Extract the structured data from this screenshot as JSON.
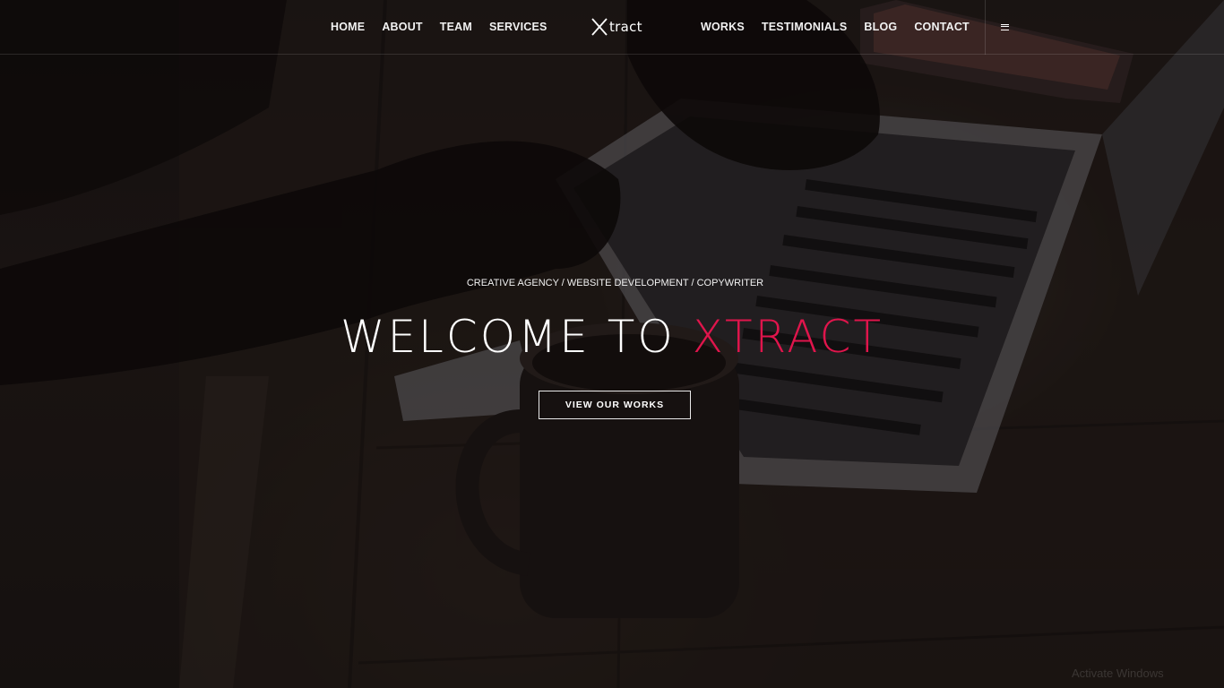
{
  "nav": {
    "left_links": [
      "HOME",
      "ABOUT",
      "TEAM",
      "SERVICES"
    ],
    "right_links": [
      "WORKS",
      "TESTIMONIALS",
      "BLOG",
      "CONTACT"
    ],
    "logo_text": "tract",
    "menu_icon": "hamburger-menu-icon"
  },
  "hero": {
    "tagline": "CREATIVE AGENCY / WEBSITE DEVELOPMENT / COPYWRITER",
    "headline_prefix": "WELCOME TO ",
    "headline_accent": "XTRACT",
    "cta_label": "VIEW OUR WORKS",
    "background": "photo of hands typing on a laptop beside a coffee mug and a smartphone on a wooden desk"
  },
  "system": {
    "watermark": "Activate Windows"
  },
  "colors": {
    "accent": "#e0154c",
    "text": "#ffffff",
    "overlay": "#141010"
  }
}
